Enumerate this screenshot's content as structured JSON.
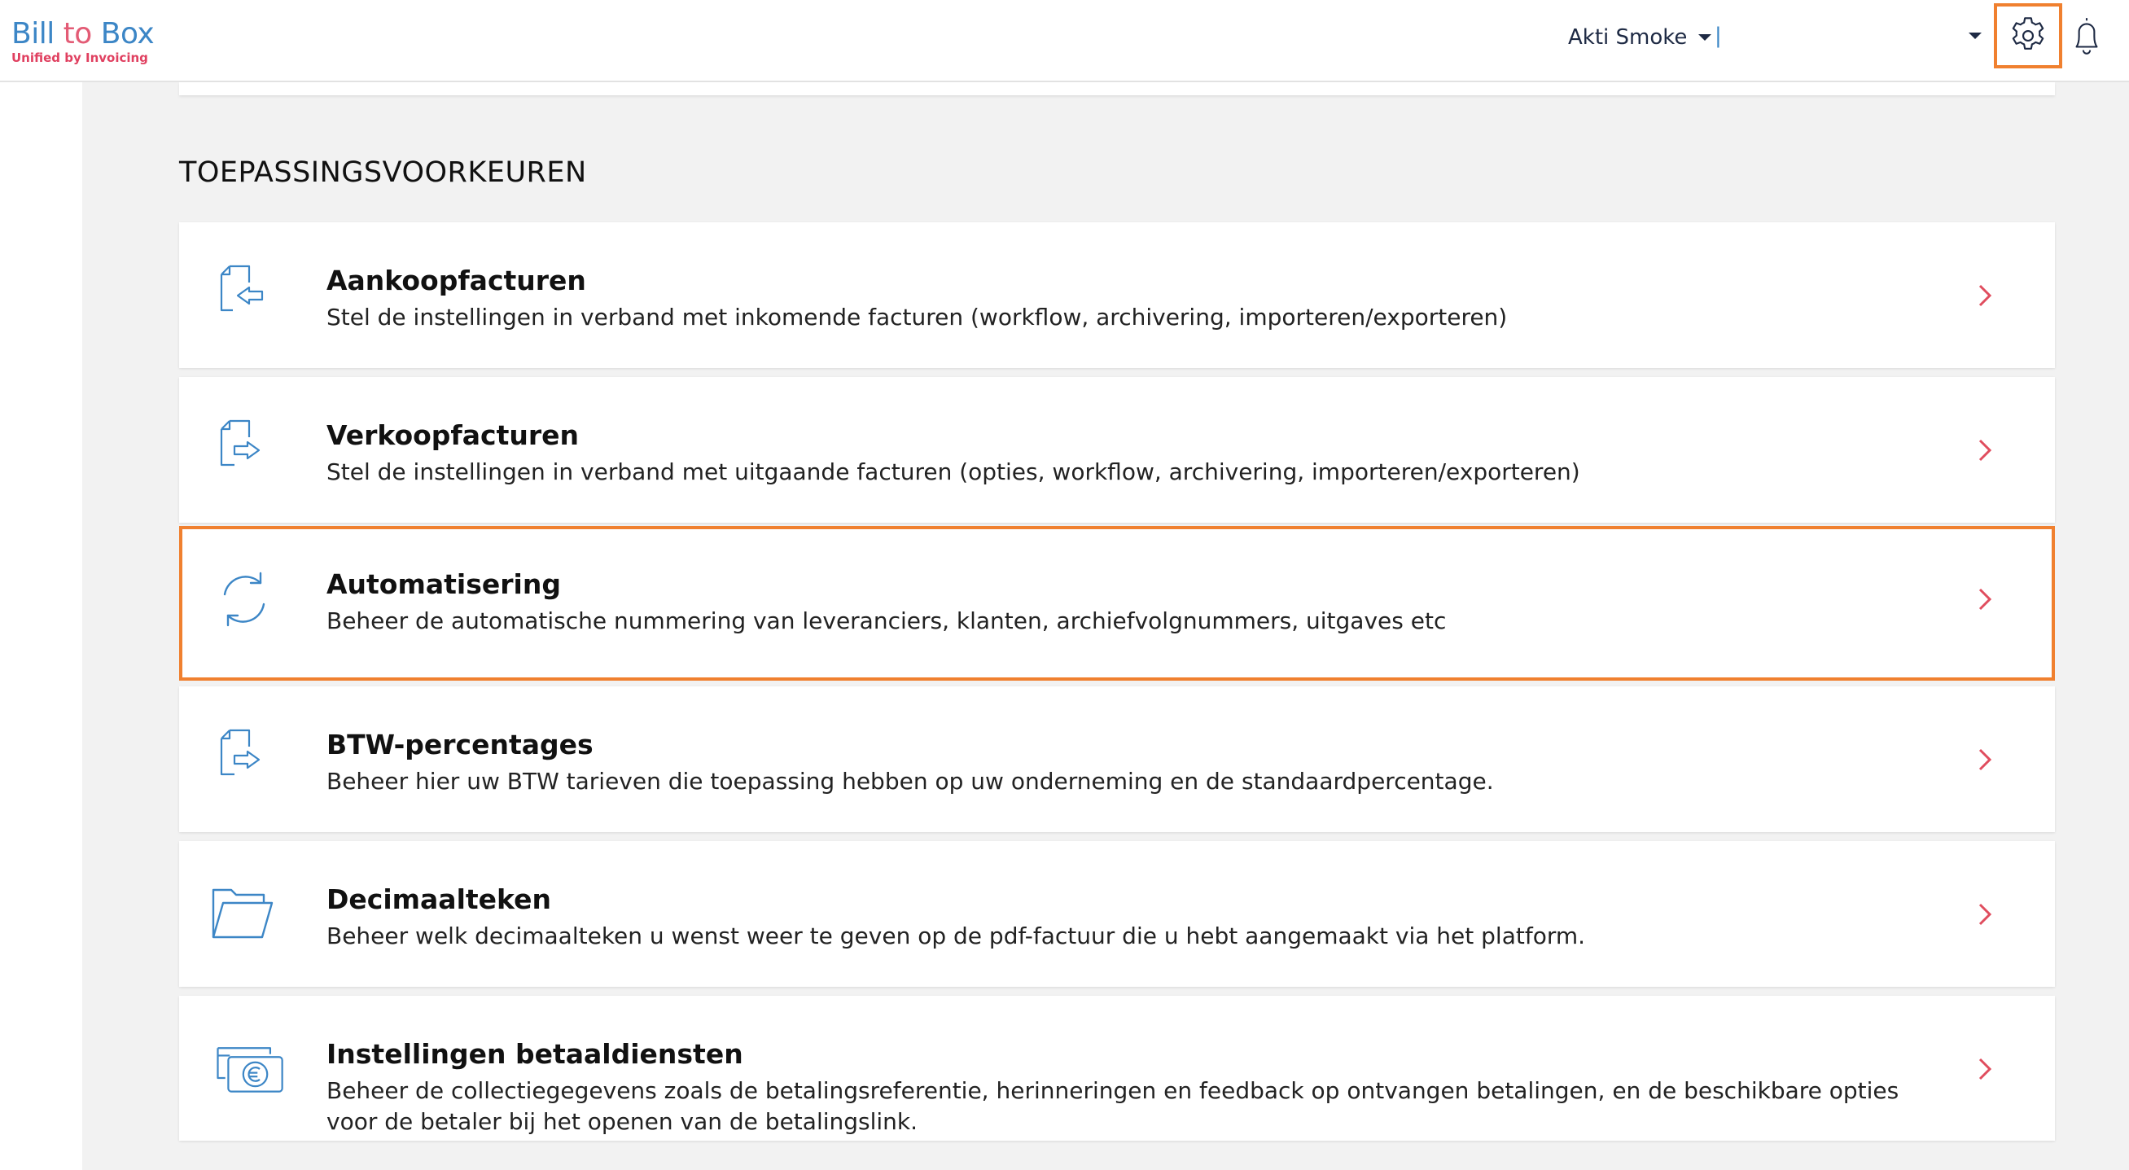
{
  "header": {
    "logo_main_pre": "Bill ",
    "logo_main_to": "to",
    "logo_main_post": " Box",
    "logo_sub": "Unified by Invoicing",
    "user_name": "Akti Smoke",
    "separator": "|"
  },
  "section_title": "TOEPASSINGSVOORKEUREN",
  "cards": [
    {
      "title": "Aankoopfacturen",
      "description": "Stel de instellingen in verband met inkomende facturen (workflow, archivering, importeren/exporteren)",
      "icon": "document-incoming-icon"
    },
    {
      "title": "Verkoopfacturen",
      "description": "Stel de instellingen in verband met uitgaande facturen (opties, workflow, archivering, importeren/exporteren)",
      "icon": "document-outgoing-icon"
    },
    {
      "title": "Automatisering",
      "description": "Beheer de automatische nummering van leveranciers, klanten, archiefvolgnummers, uitgaves etc",
      "icon": "refresh-icon"
    },
    {
      "title": "BTW-percentages",
      "description": "Beheer hier uw BTW tarieven die toepassing hebben op uw onderneming en de standaardpercentage.",
      "icon": "document-outgoing-icon"
    },
    {
      "title": "Decimaalteken",
      "description": "Beheer welk decimaalteken u wenst weer te geven op de pdf-factuur die u hebt aangemaakt via het platform.",
      "icon": "folder-open-icon"
    },
    {
      "title": "Instellingen betaaldiensten",
      "description": "Beheer de collectiegegevens zoals de betalingsreferentie, herinneringen en feedback op ontvangen betalingen, en de beschikbare opties voor de betaler bij het openen van de betalingslink.",
      "icon": "euro-payment-icon"
    }
  ],
  "colors": {
    "accent": "#f0802f",
    "icon_blue": "#3c86c6",
    "chevron": "#e04d5e",
    "background": "#f2f2f2"
  }
}
